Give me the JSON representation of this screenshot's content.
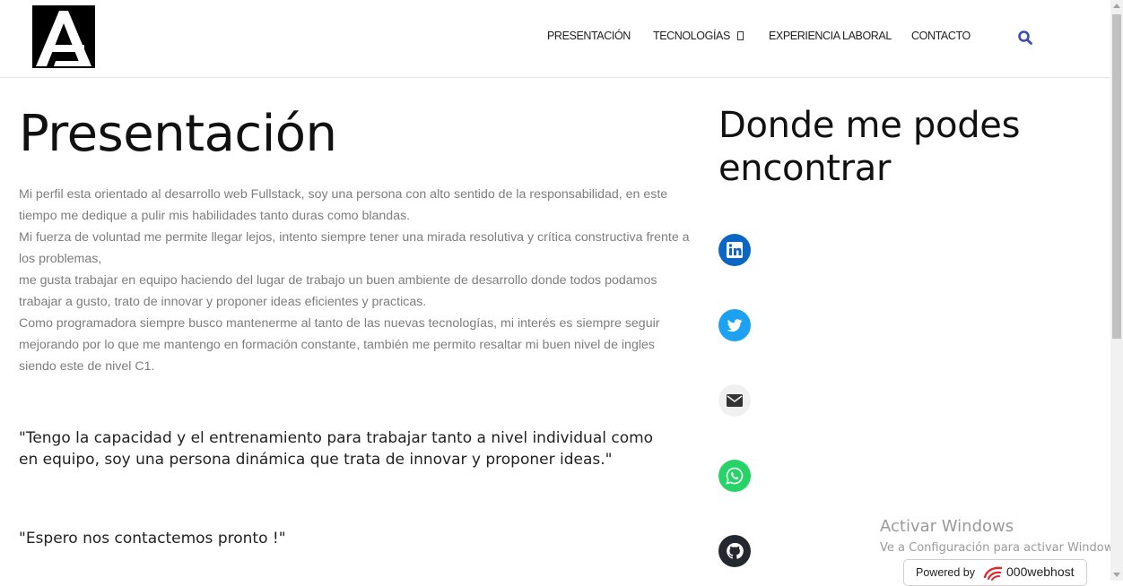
{
  "header": {
    "logo": "AA-monogram-logo",
    "nav": [
      {
        "label": "PRESENTACIÓN"
      },
      {
        "label": "TECNOLOGÍAS"
      },
      {
        "label": "EXPERIENCIA LABORAL"
      },
      {
        "label": "CONTACTO"
      }
    ],
    "search_icon": "search-icon"
  },
  "main": {
    "title": "Presentación",
    "paragraphs": [
      "Mi perfil esta orientado al desarrollo web Fullstack, soy una persona con alto sentido de la responsabilidad, en este tiempo me dedique a pulir mis habilidades tanto duras como blandas.",
      "Mi fuerza de voluntad me permite llegar lejos, intento siempre tener una mirada resolutiva y crítica constructiva frente a los problemas,",
      "me gusta trabajar en equipo haciendo del lugar de trabajo un buen ambiente de desarrollo donde todos podamos trabajar a gusto, trato de innovar y proponer ideas eficientes y practicas.",
      "Como programadora siempre busco mantenerme al tanto de las nuevas tecnologías, mi interés es siempre seguir mejorando por lo que me mantengo en formación constante, también me permito resaltar mi buen nivel de ingles siendo este de nivel C1."
    ],
    "quote1": "\"Tengo la capacidad y el entrenamiento para trabajar tanto a nivel individual como en equipo, soy una persona dinámica que trata de innovar y proponer ideas.\"",
    "quote2": "\"Espero nos contactemos pronto !\""
  },
  "sidebar": {
    "title": "Donde me podes encontrar",
    "social": [
      {
        "icon": "linkedin-icon",
        "color": "#0a66c2"
      },
      {
        "icon": "twitter-icon",
        "color": "#1da1f2"
      },
      {
        "icon": "mail-icon",
        "color": "#f0f0f0"
      },
      {
        "icon": "whatsapp-icon",
        "color": "#25d366"
      },
      {
        "icon": "github-icon",
        "color": "#24292f"
      }
    ]
  },
  "overlay": {
    "activate_title": "Activar Windows",
    "activate_sub": "Ve a Configuración para activar Windows.",
    "powered_by": "Powered by",
    "host": "000webhost"
  },
  "colors": {
    "accent": "#3d4db7",
    "text_dark": "#111111",
    "text_muted": "#7d7d7d"
  }
}
